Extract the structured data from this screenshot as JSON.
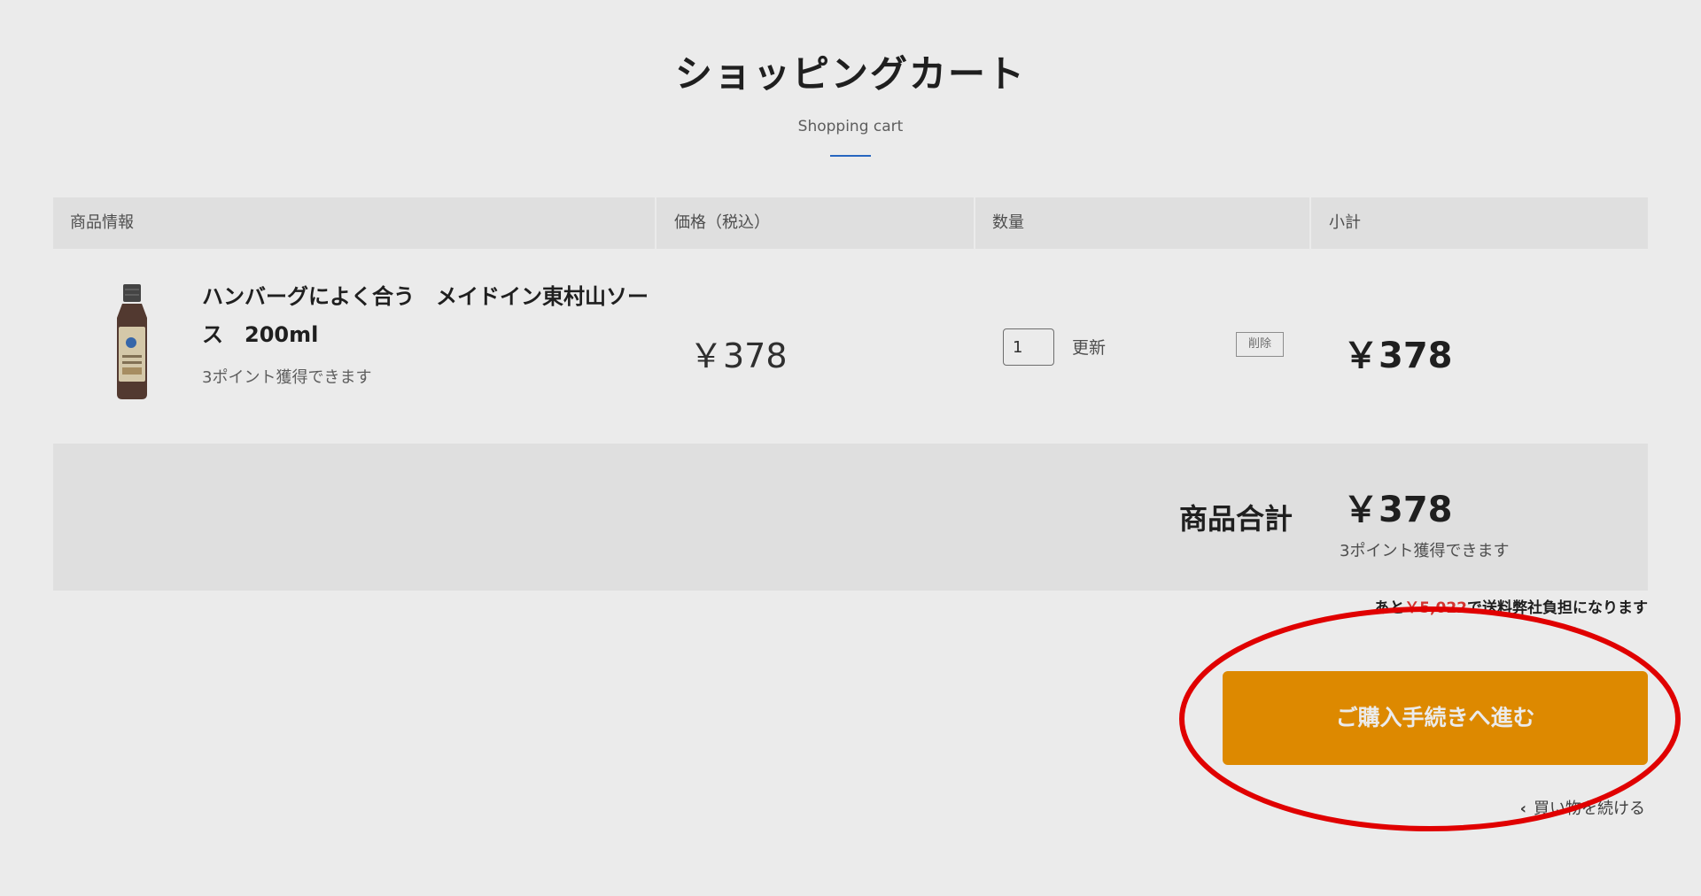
{
  "header": {
    "title": "ショッピングカート",
    "subtitle": "Shopping cart"
  },
  "table": {
    "columns": [
      "商品情報",
      "価格（税込）",
      "数量",
      "小計"
    ]
  },
  "cart_item": {
    "name": "ハンバーグによく合う　メイドイン東村山ソース　200ml",
    "points": "3ポイント獲得できます",
    "price": "￥378",
    "quantity": "1",
    "update_label": "更新",
    "delete_label": "削除",
    "subtotal": "￥378"
  },
  "summary": {
    "label": "商品合計",
    "total": "￥378",
    "points": "3ポイント獲得できます"
  },
  "shipping_note": {
    "prefix": "あと",
    "amount": "￥5,022",
    "suffix": "で送料弊社負担になります"
  },
  "actions": {
    "checkout_label": "ご購入手続きへ進む",
    "continue_label": "買い物を続ける"
  },
  "colors": {
    "accent_blue": "#2b6fd1",
    "checkout_orange": "#f09500",
    "highlight_red": "#e00000",
    "amount_red": "#e53935"
  }
}
